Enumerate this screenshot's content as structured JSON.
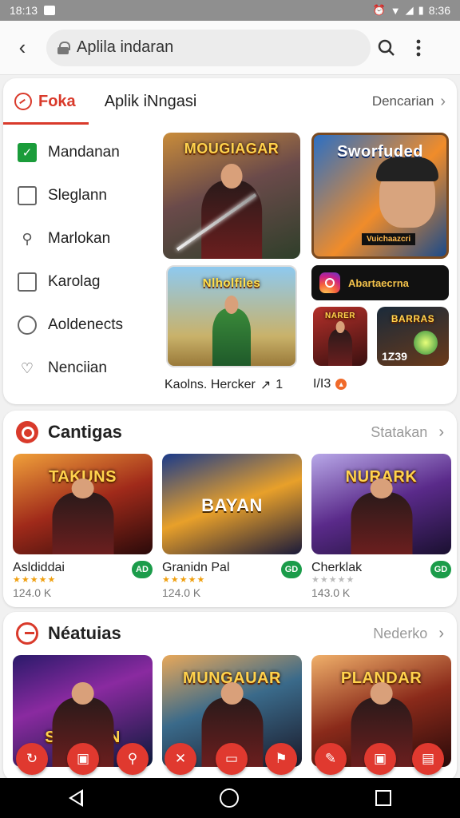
{
  "status": {
    "time": "18:13",
    "battery_time": "8:36"
  },
  "search": {
    "value": "Aplila indaran",
    "placeholder": "Aplila indaran"
  },
  "tabs": {
    "active": "Foka",
    "second": "Aplik iNngasi",
    "more": "Dencarian"
  },
  "menu": [
    {
      "label": "Mandanan",
      "icon": "check-icon"
    },
    {
      "label": "Sleglann",
      "icon": "tv-icon"
    },
    {
      "label": "Marlokan",
      "icon": "map-pin-icon"
    },
    {
      "label": "Karolag",
      "icon": "calendar-icon"
    },
    {
      "label": "Aoldenects",
      "icon": "circle-icon"
    },
    {
      "label": "Nenciian",
      "icon": "heart-icon"
    }
  ],
  "featured": {
    "tile1_title": "MOUGIAGAR",
    "tile2_title": "Sworfuded",
    "tile2_sub": "Vuichaazcri",
    "tile3_title": "Nlholfiles",
    "tile4_label": "Abartaecrna",
    "tile5_title": "NARER",
    "tile6_title": "BARRAS",
    "tile6_num": "1Z39",
    "caption_left": "Kaolns. Hercker",
    "caption_left_count": "1",
    "caption_right": "I/I3"
  },
  "section1": {
    "title": "Cantigas",
    "more": "Statakan",
    "games": [
      {
        "title_art": "TAKUNS",
        "name": "Asldiddai",
        "downloads": "124.0 K",
        "rated": true,
        "btn": "AD"
      },
      {
        "title_art": "BAYAN",
        "name": "Granidn Pal",
        "downloads": "124.0 K",
        "rated": true,
        "btn": "GD"
      },
      {
        "title_art": "NURARK",
        "name": "Cherklak",
        "downloads": "143.0 K",
        "rated": false,
        "btn": "GD"
      }
    ]
  },
  "section2": {
    "title": "Néatuias",
    "more": "Nederko",
    "games": [
      {
        "title_art": "SADIDAN"
      },
      {
        "title_art": "MUNGAUAR"
      },
      {
        "title_art": "PLANDAR"
      }
    ]
  },
  "colors": {
    "accent": "#d93a2b",
    "install": "#1b9c4a",
    "fab": "#e0392f"
  }
}
